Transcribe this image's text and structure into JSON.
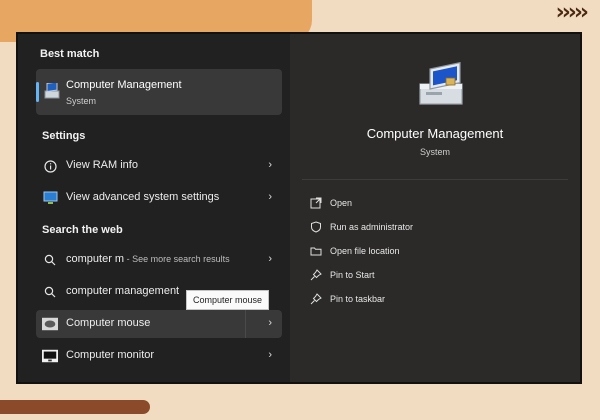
{
  "left_panel": {
    "best_match_title": "Best match",
    "best_match": {
      "title": "Computer Management",
      "subtitle": "System"
    },
    "settings_title": "Settings",
    "settings_items": [
      {
        "label": "View RAM info",
        "icon": "info-icon"
      },
      {
        "label": "View advanced system settings",
        "icon": "system-settings-icon"
      }
    ],
    "web_title": "Search the web",
    "web_items": [
      {
        "label": "computer m",
        "hint": " - See more search results",
        "icon": "search-icon"
      },
      {
        "label": "computer management",
        "icon": "search-icon"
      },
      {
        "label": "Computer mouse",
        "icon": "mouse-thumbnail-icon"
      },
      {
        "label": "Computer monitor",
        "icon": "monitor-thumbnail-icon"
      }
    ],
    "tooltip": "Computer mouse"
  },
  "right_panel": {
    "app_title": "Computer Management",
    "app_subtitle": "System",
    "actions": [
      {
        "label": "Open",
        "icon": "open-icon"
      },
      {
        "label": "Run as administrator",
        "icon": "shield-icon"
      },
      {
        "label": "Open file location",
        "icon": "folder-icon"
      },
      {
        "label": "Pin to Start",
        "icon": "pin-icon"
      },
      {
        "label": "Pin to taskbar",
        "icon": "pin-icon"
      }
    ]
  },
  "colors": {
    "accent": "#64b5f6",
    "page_background": "#f1dcc1",
    "orange_shape": "#e8a663"
  }
}
